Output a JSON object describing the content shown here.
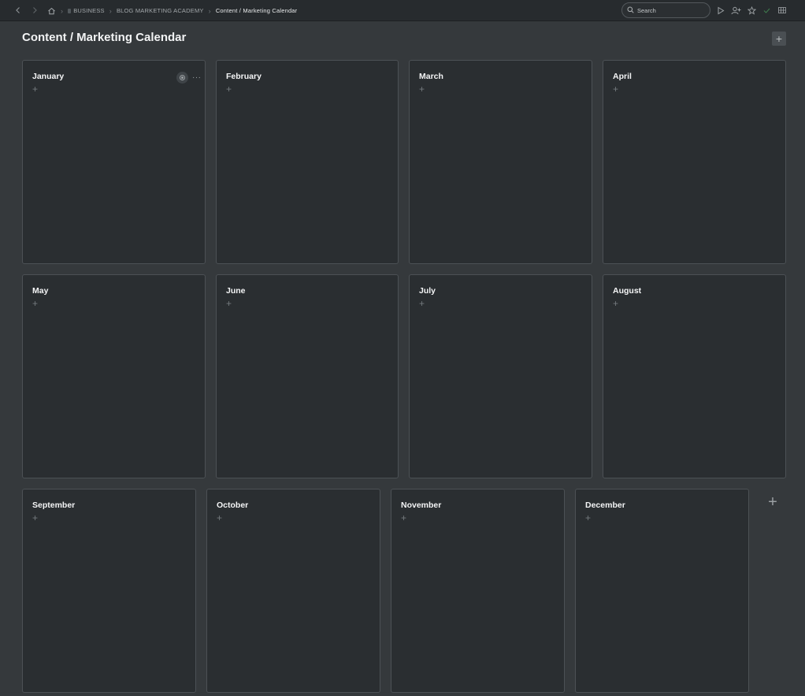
{
  "breadcrumb": {
    "workspace": "BUSINESS",
    "folder": "BLOG MARKETING ACADEMY",
    "current": "Content / Marketing Calendar"
  },
  "search": {
    "placeholder": "Search"
  },
  "page": {
    "title": "Content / Marketing Calendar"
  },
  "buttons": {
    "add_symbol": "+",
    "more_symbol": "···"
  },
  "columns": [
    {
      "title": "January"
    },
    {
      "title": "February"
    },
    {
      "title": "March"
    },
    {
      "title": "April"
    },
    {
      "title": "May"
    },
    {
      "title": "June"
    },
    {
      "title": "July"
    },
    {
      "title": "August"
    },
    {
      "title": "September"
    },
    {
      "title": "October"
    },
    {
      "title": "November"
    },
    {
      "title": "December"
    }
  ],
  "icons": {
    "back": "chevron-left-icon",
    "forward": "chevron-right-icon",
    "home": "home-icon",
    "search": "search-icon",
    "present": "play-icon",
    "share": "add-user-icon",
    "favorite": "star-icon",
    "synced": "check-icon",
    "layout": "layout-icon"
  },
  "colors": {
    "background": "#35393c",
    "card": "#2a2e31",
    "card_border": "#4c5155",
    "topbar": "#272b2e",
    "synced": "#3f7d4f"
  }
}
